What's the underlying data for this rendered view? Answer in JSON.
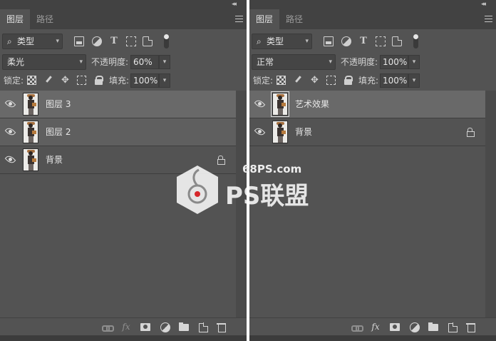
{
  "panels": [
    {
      "tabs": [
        "图层",
        "路径"
      ],
      "filter_kind": "类型",
      "blend_mode": "柔光",
      "opacity_label": "不透明度:",
      "opacity_value": "60%",
      "lock_label": "锁定:",
      "fill_label": "填充:",
      "fill_value": "100%",
      "layers": [
        {
          "name": "图层 3",
          "selected": true,
          "locked": false
        },
        {
          "name": "图层 2",
          "selected": true,
          "locked": false
        },
        {
          "name": "背景",
          "selected": false,
          "locked": true
        }
      ]
    },
    {
      "tabs": [
        "图层",
        "路径"
      ],
      "filter_kind": "类型",
      "blend_mode": "正常",
      "opacity_label": "不透明度:",
      "opacity_value": "100%",
      "lock_label": "锁定:",
      "fill_label": "填充:",
      "fill_value": "100%",
      "layers": [
        {
          "name": "艺术效果",
          "selected": true,
          "locked": false
        },
        {
          "name": "背景",
          "selected": false,
          "locked": true
        }
      ]
    }
  ],
  "icons": {
    "search": "search-icon",
    "filter": [
      "image-filter-icon",
      "adjustment-filter-icon",
      "type-filter-icon",
      "shape-filter-icon",
      "smart-object-filter-icon"
    ],
    "lock": [
      "lock-transparent-icon",
      "lock-image-icon",
      "lock-position-icon",
      "lock-artboard-icon",
      "lock-all-icon"
    ],
    "footer": [
      "link-layers-icon",
      "fx-icon",
      "add-mask-icon",
      "adjustment-layer-icon",
      "group-folder-icon",
      "new-layer-icon",
      "delete-trash-icon"
    ],
    "fx_text": "fx",
    "chevron": "▾",
    "collapse": "◂◂"
  },
  "watermark": {
    "url": "68PS.com",
    "colors": {
      "badge": "#ffffff",
      "dot": "#d6272a",
      "text": "#ffffff"
    }
  },
  "colors": {
    "panel_bg": "#535353",
    "tabbar_bg": "#424242",
    "selected_layer": "#696969",
    "divider": "#ffffff"
  }
}
